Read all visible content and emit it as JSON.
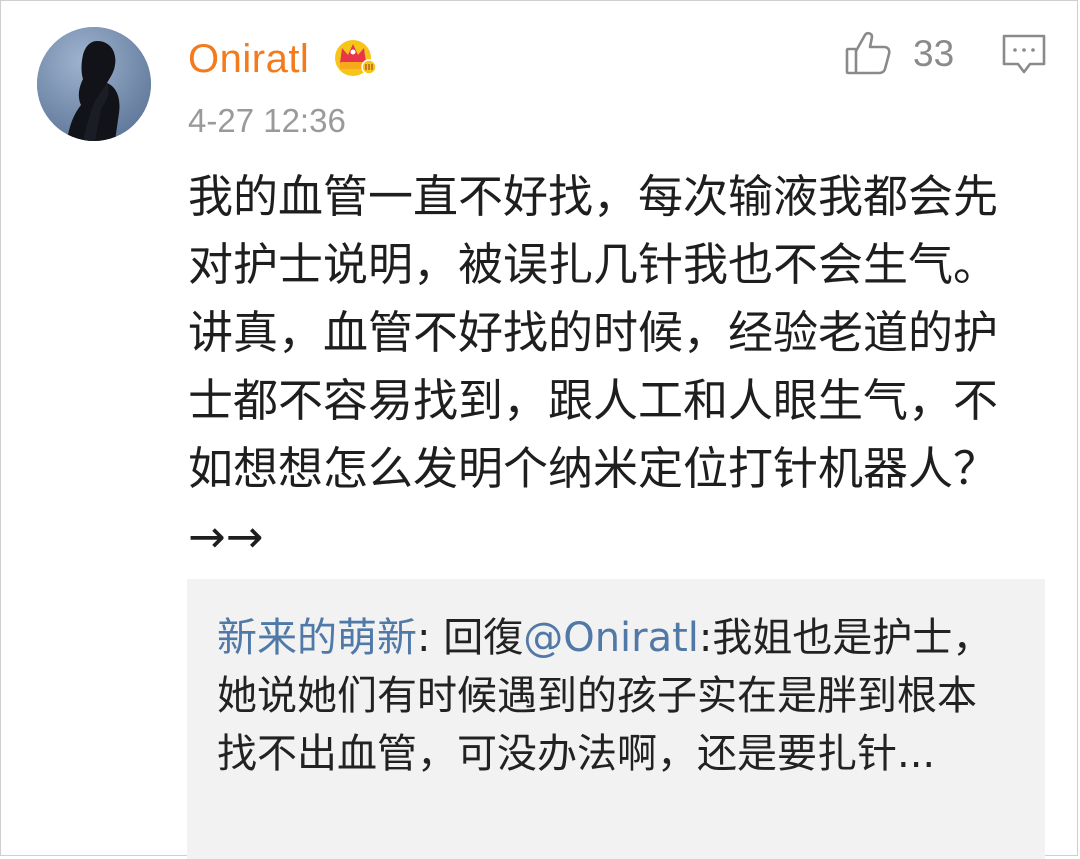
{
  "comment": {
    "username": "Oniratl",
    "badge_icon": "crown-badge-icon",
    "timestamp": "4-27 12:36",
    "like_icon": "thumbs-up-icon",
    "like_count": "33",
    "reply_icon": "comment-bubble-icon",
    "text": "我的血管一直不好找，每次输液我都会先对护士说明，被误扎几针我也不会生气。讲真，血管不好找的时候，经验老道的护士都不容易找到，跟人工和人眼生气，不如想想怎么发明个纳米定位打针机器人？→→"
  },
  "reply": {
    "author": "新来的萌新",
    "separator": ": 回復",
    "mention": "@Oniratl",
    "text": ":我姐也是护士，她说她们有时候遇到的孩子实在是胖到根本找不出血管，可没办法啊，还是要扎针..."
  },
  "colors": {
    "username": "#f37b1d",
    "link": "#5079a8",
    "timestamp": "#9a9a9a",
    "reply_bg": "#f2f2f2",
    "text": "#1e1e1e"
  }
}
